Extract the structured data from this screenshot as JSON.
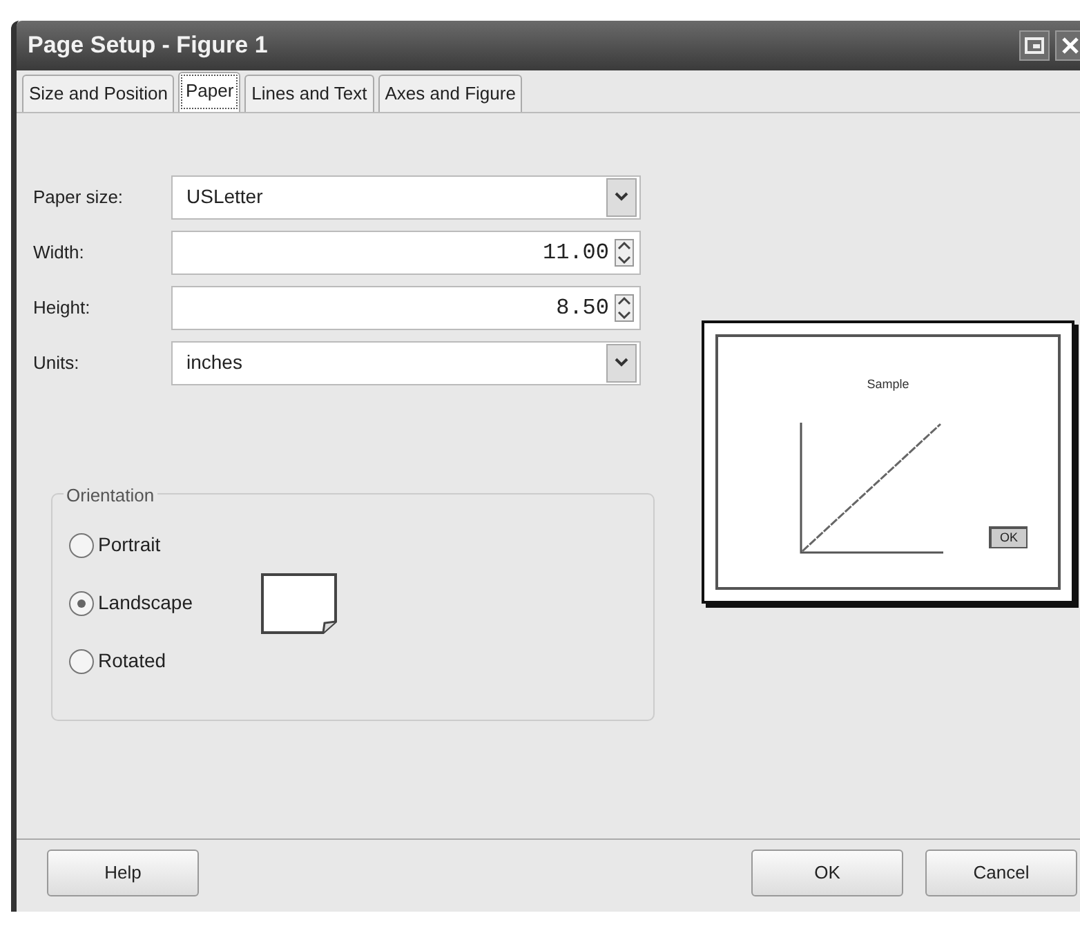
{
  "window": {
    "title": "Page Setup - Figure 1"
  },
  "tabs": [
    {
      "label": "Size and Position",
      "selected": false
    },
    {
      "label": "Paper",
      "selected": true
    },
    {
      "label": "Lines and Text",
      "selected": false
    },
    {
      "label": "Axes and Figure",
      "selected": false
    }
  ],
  "fields": [
    {
      "kind": "dropdown",
      "label": "Paper size:",
      "value": "USLetter"
    },
    {
      "kind": "spinner",
      "label": "Width:",
      "value": "11.00"
    },
    {
      "kind": "spinner",
      "label": "Height:",
      "value": "8.50"
    },
    {
      "kind": "dropdown",
      "label": "Units:",
      "value": "inches"
    }
  ],
  "orientation": {
    "title": "Orientation",
    "options": [
      {
        "label": "Portrait",
        "selected": false
      },
      {
        "label": "Landscape",
        "selected": true
      },
      {
        "label": "Rotated",
        "selected": false
      }
    ]
  },
  "preview": {
    "title": "Sample",
    "button": "OK"
  },
  "help_button": "Help",
  "buttons": [
    "OK",
    "Cancel"
  ]
}
